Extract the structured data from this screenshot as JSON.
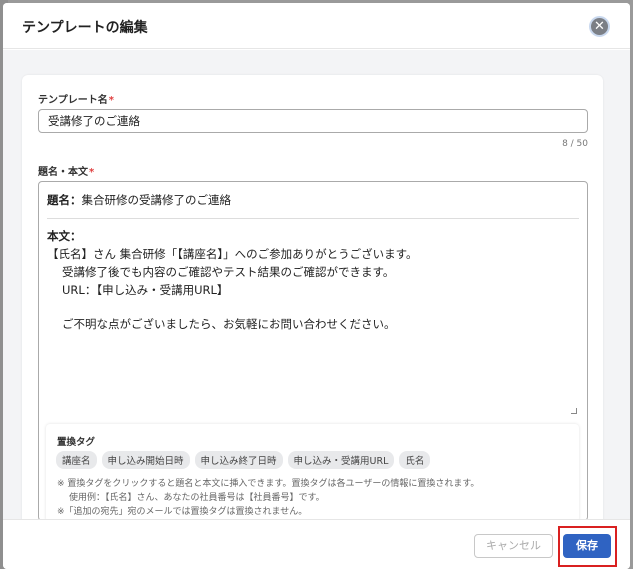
{
  "modal": {
    "title": "テンプレートの編集",
    "close_glyph": "✕"
  },
  "template_name": {
    "label": "テンプレート名",
    "required_mark": "*",
    "value": "受講修了のご連絡",
    "counter": "8 / 50"
  },
  "subject_body": {
    "label": "題名・本文",
    "required_mark": "*",
    "subject_label": "題名：",
    "subject_value": "集合研修の受講修了のご連絡",
    "body_label": "本文：",
    "body_lines": [
      "【氏名】さん 集合研修「【講座名】」へのご参加ありがとうございます。",
      "受講修了後でも内容のご確認やテスト結果のご確認ができます。",
      "URL：【申し込み・受講用URL】",
      "ご不明な点がございましたら、お気軽にお問い合わせください。"
    ]
  },
  "replacement_tags": {
    "title": "置換タグ",
    "tags": [
      "講座名",
      "申し込み開始日時",
      "申し込み終了日時",
      "申し込み・受講用URL",
      "氏名"
    ],
    "notes": [
      "※ 置換タグをクリックすると題名と本文に挿入できます。置換タグは各ユーザーの情報に置換されます。",
      "使用例：【氏名】さん、あなたの社員番号は【社員番号】です。",
      "※「追加の宛先」宛のメールでは置換タグは置換されません。"
    ]
  },
  "footer": {
    "cancel_label": "キャンセル",
    "save_label": "保存"
  }
}
